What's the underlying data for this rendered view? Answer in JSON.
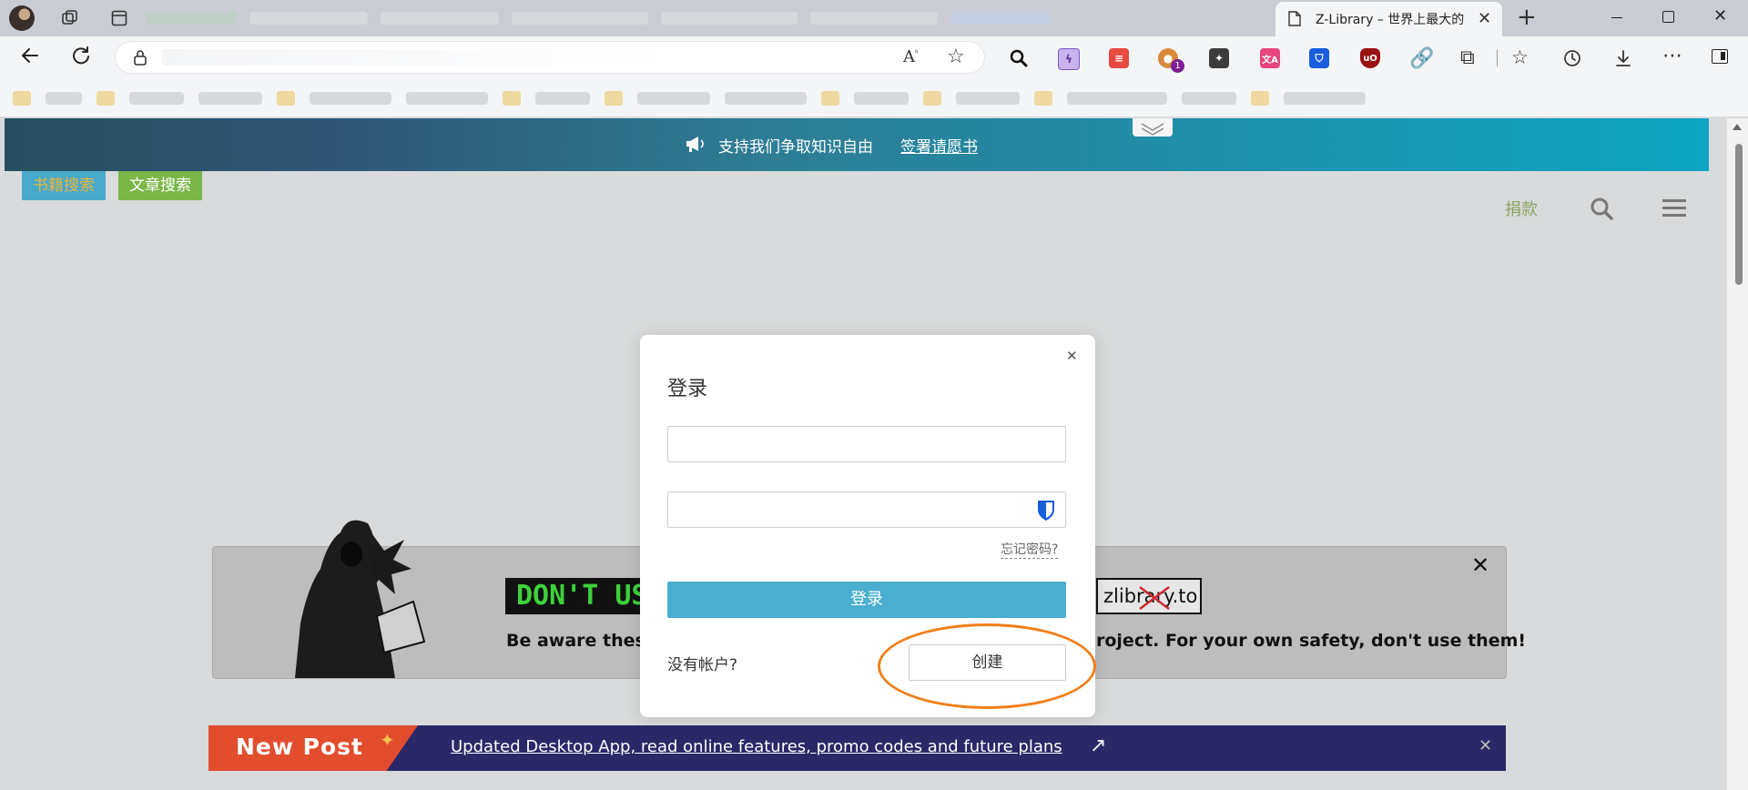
{
  "browser": {
    "active_tab_title": "Z-Library – 世界上最大的",
    "omnibox_url": "",
    "extension_badge": "1"
  },
  "banner": {
    "text": "支持我们争取知识自由",
    "link": "签署请愿书"
  },
  "nav": {
    "tab_books": "书籍搜索",
    "tab_articles": "文章搜索",
    "donate": "捐款"
  },
  "warning": {
    "headline": "DON'T USE",
    "domain_tag": "zlibrary.to",
    "line_left": "Be aware these f",
    "line_right": "roject. For your own safety, don't use them!"
  },
  "new_post": {
    "badge": "New Post",
    "link": "Updated Desktop App, read online features, promo codes and future plans"
  },
  "modal": {
    "title": "登录",
    "email_value": "",
    "password_value": "",
    "forgot": "忘记密码?",
    "login_button": "登录",
    "no_account": "没有帐户?",
    "create_button": "创建"
  },
  "colors": {
    "book_tab_bg": "#49a9cb",
    "book_tab_text": "#e8b63a",
    "article_tab_bg": "#7ab648",
    "login_button": "#49aecf",
    "donate": "#8aa35c",
    "annotation_ring": "#f07f1a"
  }
}
